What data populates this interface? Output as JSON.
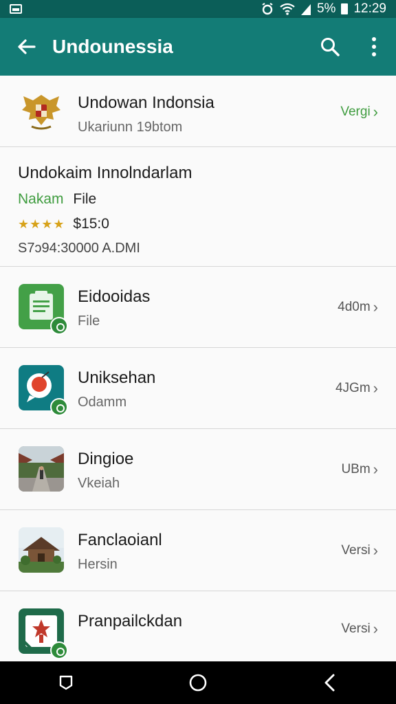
{
  "status": {
    "battery": "5%",
    "time": "12:29"
  },
  "app_bar": {
    "title": "Undounessia"
  },
  "featured": {
    "name": "Undowan Indonsia",
    "subtitle": "Ukariunn 19btom",
    "meta": "Vergi"
  },
  "detail": {
    "title": "Undokaim Innolndarlam",
    "tag": "Nakam",
    "type": "File",
    "stars": "★★★★",
    "price": "$15:0",
    "id": "S7ↄ94:30000 A.DMI"
  },
  "items": [
    {
      "name": "Eidooidas",
      "subtitle": "File",
      "meta": "4d0m",
      "icon": "document-icon"
    },
    {
      "name": "Uniksehan",
      "subtitle": "Odamm",
      "meta": "4JGm",
      "icon": "chat-icon"
    },
    {
      "name": "Dingioe",
      "subtitle": "Vkeiah",
      "meta": "UBm",
      "icon": "photo-icon"
    },
    {
      "name": "Fanclaoianl",
      "subtitle": "Hersin",
      "meta": "Versi",
      "icon": "house-photo-icon"
    },
    {
      "name": "Pranpailckdan",
      "subtitle": "",
      "meta": "Versi",
      "icon": "emblem-icon"
    }
  ],
  "colors": {
    "app_bar": "#137c76",
    "status_bar": "#0b5e58",
    "accent_green": "#3f9c3f",
    "star": "#d7a21a"
  }
}
